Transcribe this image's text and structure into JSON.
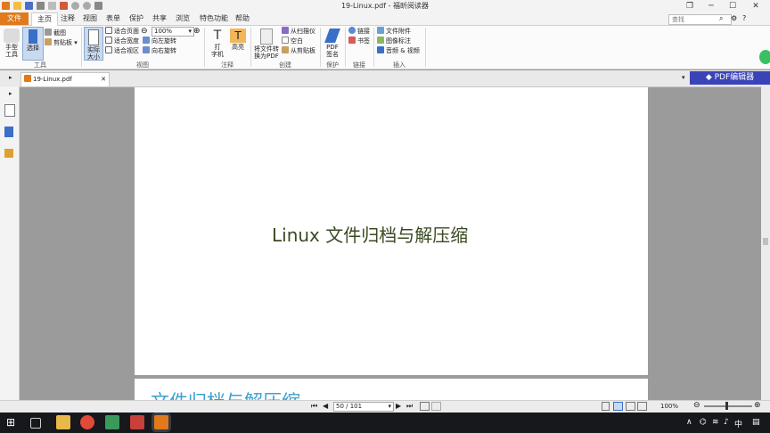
{
  "window": {
    "title": "19-Linux.pdf - 福昕阅读器",
    "controls": [
      "❐",
      "─",
      "☐",
      "✕"
    ]
  },
  "menu": {
    "tabs": [
      "文件",
      "主页",
      "注释",
      "视图",
      "表单",
      "保护",
      "共享",
      "浏览",
      "特色功能",
      "帮助"
    ],
    "search_placeholder": "查找"
  },
  "ribbon": {
    "tools": {
      "hand": "手型\n工具",
      "select": "选择",
      "snapshot": "截图",
      "clipboard": "剪贴板",
      "group": "工具"
    },
    "view": {
      "actual_size": "实际\n大小",
      "fit_page": "适合页面",
      "fit_width": "适合宽度",
      "fit_visible": "适合视区",
      "zoom_value": "100%",
      "rotate_left": "向左旋转",
      "rotate_right": "向右旋转",
      "group": "视图"
    },
    "comment": {
      "typewriter": "打\n字机",
      "highlight": "高亮",
      "group": "注释"
    },
    "create": {
      "convert": "将文件转\n换为PDF",
      "from_scanner": "从扫描仪",
      "blank": "空白",
      "from_clipboard": "从剪贴板",
      "group": "创建"
    },
    "protect": {
      "sign": "PDF\n签名",
      "group": "保护"
    },
    "links": {
      "link": "链接",
      "bookmark": "书签",
      "group": "链接"
    },
    "insert": {
      "attachment": "文件附件",
      "image": "图像标注",
      "media": "音频 & 视频",
      "group": "插入"
    }
  },
  "pdf_editor_button": "PDF编辑器",
  "doc_tab": {
    "name": "19-Linux.pdf"
  },
  "document": {
    "page_heading": "Linux 文件归档与解压缩",
    "next_page_heading": "文件归档与解压缩"
  },
  "status": {
    "page_indicator": "50 / 101",
    "zoom": "100%"
  },
  "taskbar": {
    "time": "中"
  },
  "colors": {
    "accent_orange": "#e07a1c",
    "pdf_editor_blue": "#3a43b8",
    "heading_green": "#3a4a22",
    "heading_blue": "#3aa0d0"
  }
}
